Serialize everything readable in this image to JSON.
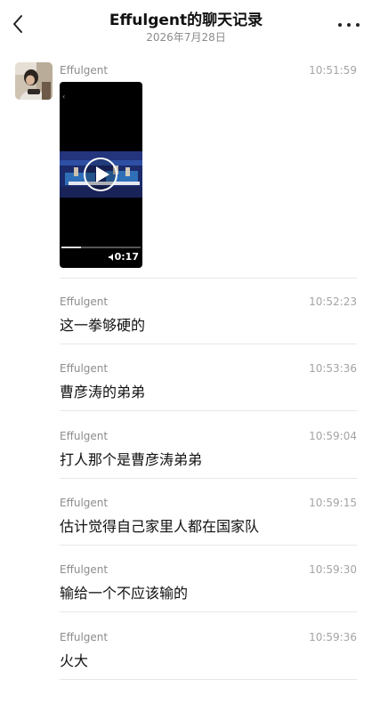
{
  "header": {
    "title": "Effulgent的聊天记录",
    "date": "2026年7月28日"
  },
  "icons": {
    "back": "chevron-left-icon",
    "more": "more-horizontal-icon",
    "play": "play-icon",
    "mute": "mute-icon"
  },
  "colors": {
    "divider": "#e8e8e8",
    "timestamp": "#a4a4a4",
    "sender": "#8c8c8c",
    "text": "#111111"
  },
  "messages": [
    {
      "sender": "Effulgent",
      "time": "10:51:59",
      "type": "video",
      "video": {
        "duration": "0:17",
        "progress": 0.25
      }
    },
    {
      "sender": "Effulgent",
      "time": "10:52:23",
      "type": "text",
      "text": "这一拳够硬的"
    },
    {
      "sender": "Effulgent",
      "time": "10:53:36",
      "type": "text",
      "text": "曹彦涛的弟弟"
    },
    {
      "sender": "Effulgent",
      "time": "10:59:04",
      "type": "text",
      "text": "打人那个是曹彦涛弟弟"
    },
    {
      "sender": "Effulgent",
      "time": "10:59:15",
      "type": "text",
      "text": "估计觉得自己家里人都在国家队"
    },
    {
      "sender": "Effulgent",
      "time": "10:59:30",
      "type": "text",
      "text": "输给一个不应该输的"
    },
    {
      "sender": "Effulgent",
      "time": "10:59:36",
      "type": "text",
      "text": "火大"
    }
  ]
}
